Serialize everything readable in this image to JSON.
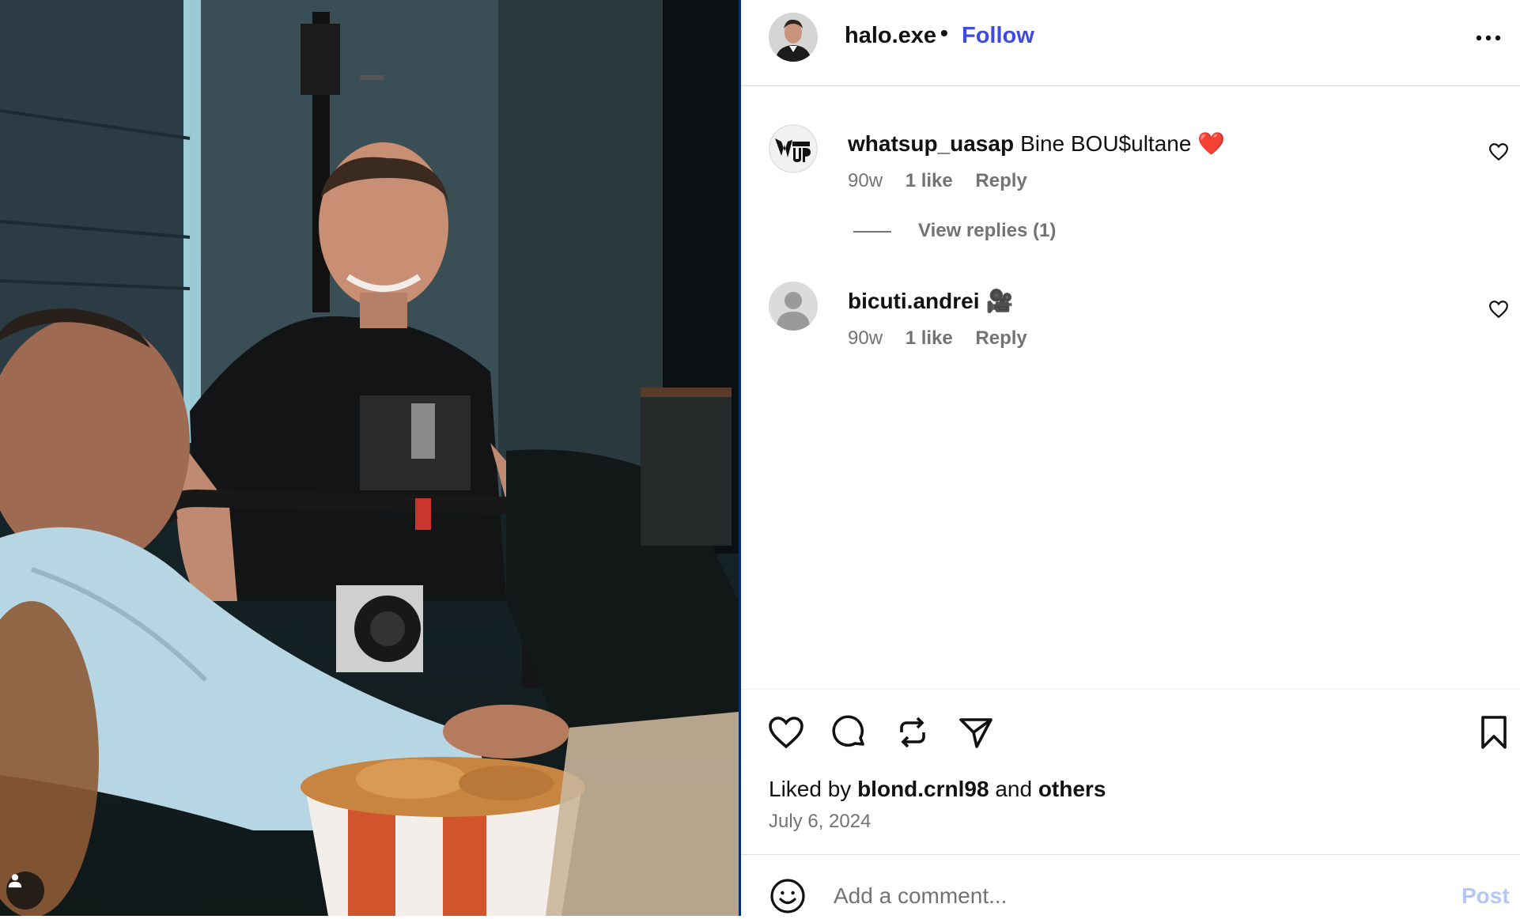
{
  "post": {
    "author": "halo.exe",
    "separator": "•",
    "follow_label": "Follow",
    "more_label": "More options"
  },
  "comments": [
    {
      "username": "whatsup_uasap",
      "text": "Bine BOU$ultane ❤️",
      "age": "90w",
      "likes": "1 like",
      "reply_label": "Reply",
      "view_replies": "View replies (1)"
    },
    {
      "username": "bicuti.andrei",
      "text": "🎥",
      "age": "90w",
      "likes": "1 like",
      "reply_label": "Reply"
    }
  ],
  "liked_by": {
    "prefix": "Liked by",
    "user": "blond.crnl98",
    "conj": "and",
    "others": "others"
  },
  "date": "July 6, 2024",
  "comment_box": {
    "placeholder": "Add a comment...",
    "post_label": "Post"
  },
  "icons": {
    "like": "heart-icon",
    "comment": "comment-icon",
    "repost": "repost-icon",
    "share": "send-icon",
    "save": "bookmark-icon",
    "emoji": "emoji-icon",
    "more": "more-dots-icon",
    "user_tag": "person-icon"
  },
  "colors": {
    "follow": "#3e4be0",
    "post_disabled": "#b3c7f7",
    "meta_gray": "#737373"
  }
}
